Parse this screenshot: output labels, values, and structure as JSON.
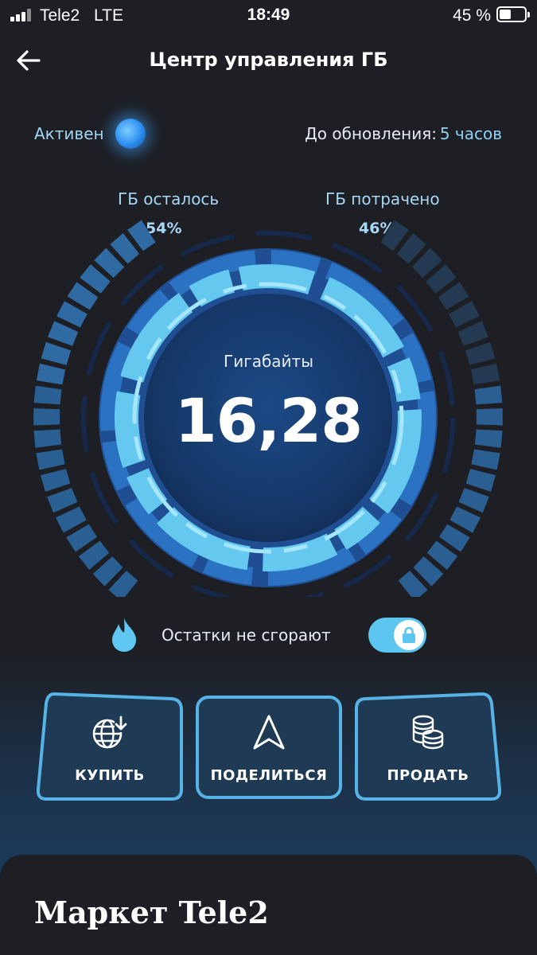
{
  "status_bar": {
    "carrier": "Tele2",
    "network": "LTE",
    "time": "18:49",
    "battery_percent": "45 %",
    "battery_level": 0.45
  },
  "header": {
    "title": "Центр управления ГБ",
    "back_icon": "arrow-left-icon"
  },
  "status": {
    "active_label": "Активен",
    "update_label": "До обновления:",
    "update_value": "5 часов"
  },
  "gauge": {
    "left_heading": "ГБ осталось",
    "left_percent": "54%",
    "right_heading": "ГБ потрачено",
    "right_percent": "46%",
    "caption": "Гигабайты",
    "value": "16,28"
  },
  "rollover": {
    "label": "Остатки не сгорают",
    "icon": "flame-icon",
    "toggle_on": true,
    "toggle_icon": "lock-icon"
  },
  "actions": [
    {
      "label": "КУПИТЬ",
      "icon": "globe-download-icon"
    },
    {
      "label": "ПОДЕЛИТЬСЯ",
      "icon": "navigation-arrow-icon"
    },
    {
      "label": "ПРОДАТЬ",
      "icon": "coins-stack-icon"
    }
  ],
  "market": {
    "title": "Маркет Tele2"
  },
  "colors": {
    "background": "#1d1f24",
    "accent": "#5cc5f0",
    "ring_light": "#6ed3f5",
    "ring_dark": "#1f5fa8",
    "label_blue": "#a7d8f5"
  }
}
